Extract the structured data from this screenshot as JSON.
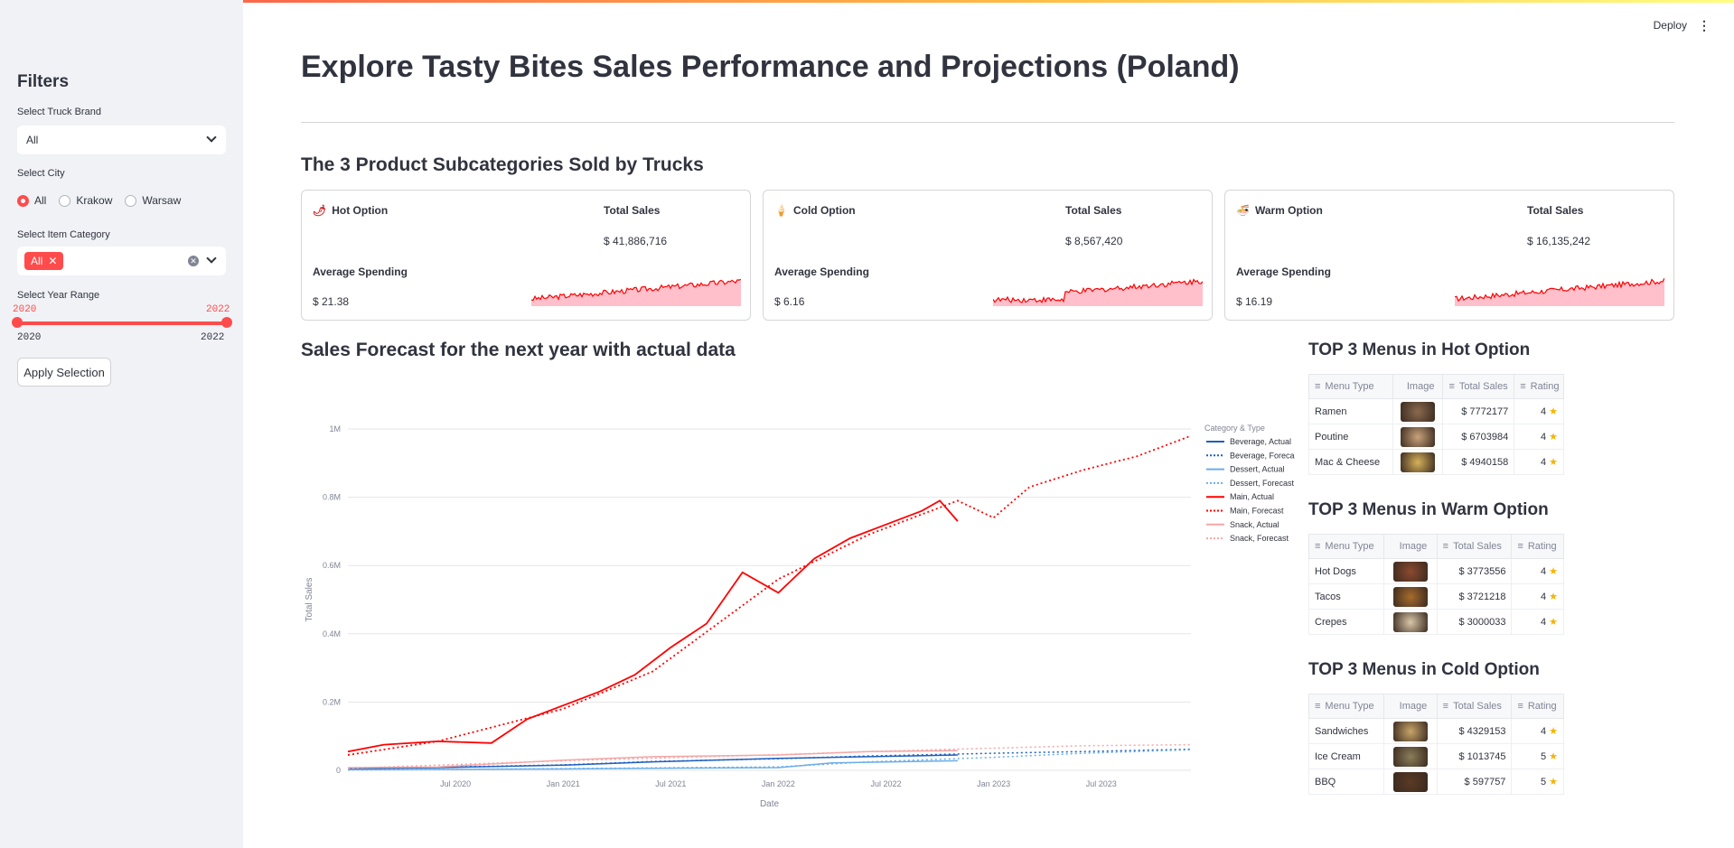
{
  "header": {
    "deploy_label": "Deploy",
    "menu_icon": "kebab-menu-icon"
  },
  "sidebar": {
    "title": "Filters",
    "truck_brand": {
      "label": "Select Truck Brand",
      "value": "All"
    },
    "city": {
      "label": "Select City",
      "options": [
        "All",
        "Krakow",
        "Warsaw"
      ],
      "selected": "All"
    },
    "item_category": {
      "label": "Select Item Category",
      "tag": "All"
    },
    "year_range": {
      "label": "Select Year Range",
      "min": "2020",
      "max": "2022",
      "low": "2020",
      "high": "2022"
    },
    "apply_label": "Apply Selection"
  },
  "main": {
    "title": "Explore Tasty Bites Sales Performance and Projections (Poland)",
    "subcategories_title": "The 3 Product Subcategories Sold by Trucks",
    "cards": [
      {
        "name": "Hot Option",
        "icon": "chili-pepper-icon",
        "total_sales_label": "Total Sales",
        "total_sales": "$ 41,886,716",
        "avg_label": "Average Spending",
        "avg": "$ 21.38"
      },
      {
        "name": "Cold Option",
        "icon": "ice-cream-icon",
        "total_sales_label": "Total Sales",
        "total_sales": "$ 8,567,420",
        "avg_label": "Average Spending",
        "avg": "$ 6.16"
      },
      {
        "name": "Warm Option",
        "icon": "bowl-icon",
        "total_sales_label": "Total Sales",
        "total_sales": "$ 16,135,242",
        "avg_label": "Average Spending",
        "avg": "$ 16.19"
      }
    ],
    "forecast_title": "Sales Forecast for the next year with actual data"
  },
  "tables": [
    {
      "title": "TOP 3 Menus in Hot Option",
      "headers": [
        "Menu Type",
        "Image",
        "Total Sales",
        "Rating"
      ],
      "rows": [
        {
          "menu": "Ramen",
          "sales": "$ 7772177",
          "rating": "4"
        },
        {
          "menu": "Poutine",
          "sales": "$ 6703984",
          "rating": "4"
        },
        {
          "menu": "Mac & Cheese",
          "sales": "$ 4940158",
          "rating": "4"
        }
      ]
    },
    {
      "title": "TOP 3 Menus in Warm Option",
      "headers": [
        "Menu Type",
        "Image",
        "Total Sales",
        "Rating"
      ],
      "rows": [
        {
          "menu": "Hot Dogs",
          "sales": "$ 3773556",
          "rating": "4"
        },
        {
          "menu": "Tacos",
          "sales": "$ 3721218",
          "rating": "4"
        },
        {
          "menu": "Crepes",
          "sales": "$ 3000033",
          "rating": "4"
        }
      ]
    },
    {
      "title": "TOP 3 Menus in Cold Option",
      "headers": [
        "Menu Type",
        "Image",
        "Total Sales",
        "Rating"
      ],
      "rows": [
        {
          "menu": "Sandwiches",
          "sales": "$ 4329153",
          "rating": "4"
        },
        {
          "menu": "Ice Cream",
          "sales": "$ 1013745",
          "rating": "5"
        },
        {
          "menu": "BBQ",
          "sales": "$ 597757",
          "rating": "5"
        }
      ]
    }
  ],
  "colors": {
    "accent": "#ff4b4b",
    "main": "#ff0000",
    "beverage": "#1f5fbf",
    "dessert": "#6aaee8",
    "snack": "#f4a7a7"
  },
  "chart_data": {
    "type": "line",
    "xlabel": "Date",
    "ylabel": "Total Sales",
    "x_ticks": [
      "Jul 2020",
      "Jan 2021",
      "Jul 2021",
      "Jan 2022",
      "Jul 2022",
      "Jan 2023",
      "Jul 2023"
    ],
    "y_ticks": [
      "0",
      "0.2M",
      "0.4M",
      "0.6M",
      "0.8M",
      "1M"
    ],
    "ylim": [
      0,
      1000000
    ],
    "xlim": [
      "2020-01",
      "2023-12"
    ],
    "legend_title": "Category & Type",
    "legend_position": "right",
    "series": [
      {
        "name": "Beverage, Actual",
        "style": "solid",
        "color": "#1f5fbf",
        "points": [
          [
            "2020-01",
            5000
          ],
          [
            "2020-06",
            8000
          ],
          [
            "2021-01",
            15000
          ],
          [
            "2021-06",
            25000
          ],
          [
            "2022-01",
            35000
          ],
          [
            "2022-06",
            40000
          ],
          [
            "2022-11",
            45000
          ]
        ]
      },
      {
        "name": "Beverage, Forecast",
        "style": "dotted",
        "color": "#1f5fbf",
        "points": [
          [
            "2020-01",
            3000
          ],
          [
            "2020-06",
            9000
          ],
          [
            "2021-01",
            16000
          ],
          [
            "2021-06",
            26000
          ],
          [
            "2022-01",
            34000
          ],
          [
            "2022-06",
            42000
          ],
          [
            "2023-01",
            50000
          ],
          [
            "2023-06",
            55000
          ],
          [
            "2023-12",
            62000
          ]
        ]
      },
      {
        "name": "Dessert, Actual",
        "style": "solid",
        "color": "#6aaee8",
        "points": [
          [
            "2020-01",
            2000
          ],
          [
            "2020-06",
            3000
          ],
          [
            "2021-01",
            4000
          ],
          [
            "2021-06",
            6000
          ],
          [
            "2022-01",
            8000
          ],
          [
            "2022-04",
            22000
          ],
          [
            "2022-11",
            28000
          ]
        ]
      },
      {
        "name": "Dessert, Forecast",
        "style": "dotted",
        "color": "#6aaee8",
        "points": [
          [
            "2020-01",
            1000
          ],
          [
            "2021-01",
            5000
          ],
          [
            "2022-01",
            10000
          ],
          [
            "2022-06",
            25000
          ],
          [
            "2023-01",
            38000
          ],
          [
            "2023-06",
            50000
          ],
          [
            "2023-12",
            60000
          ]
        ]
      },
      {
        "name": "Main, Actual",
        "style": "solid",
        "color": "#ff0000",
        "points": [
          [
            "2020-01",
            55000
          ],
          [
            "2020-03",
            75000
          ],
          [
            "2020-06",
            85000
          ],
          [
            "2020-09",
            80000
          ],
          [
            "2020-11",
            150000
          ],
          [
            "2021-01",
            190000
          ],
          [
            "2021-03",
            230000
          ],
          [
            "2021-05",
            280000
          ],
          [
            "2021-07",
            360000
          ],
          [
            "2021-09",
            430000
          ],
          [
            "2021-11",
            580000
          ],
          [
            "2022-01",
            520000
          ],
          [
            "2022-03",
            620000
          ],
          [
            "2022-05",
            680000
          ],
          [
            "2022-07",
            720000
          ],
          [
            "2022-09",
            760000
          ],
          [
            "2022-10",
            790000
          ],
          [
            "2022-11",
            730000
          ]
        ]
      },
      {
        "name": "Main, Forecast",
        "style": "dotted",
        "color": "#ff0000",
        "points": [
          [
            "2020-01",
            45000
          ],
          [
            "2020-06",
            85000
          ],
          [
            "2021-01",
            180000
          ],
          [
            "2021-06",
            290000
          ],
          [
            "2022-01",
            560000
          ],
          [
            "2022-06",
            690000
          ],
          [
            "2022-11",
            790000
          ],
          [
            "2023-01",
            740000
          ],
          [
            "2023-03",
            830000
          ],
          [
            "2023-06",
            880000
          ],
          [
            "2023-09",
            920000
          ],
          [
            "2023-12",
            980000
          ]
        ]
      },
      {
        "name": "Snack, Actual",
        "style": "solid",
        "color": "#f4a7a7",
        "points": [
          [
            "2020-01",
            8000
          ],
          [
            "2020-06",
            10000
          ],
          [
            "2021-01",
            30000
          ],
          [
            "2021-06",
            40000
          ],
          [
            "2022-01",
            45000
          ],
          [
            "2022-06",
            55000
          ],
          [
            "2022-11",
            58000
          ]
        ]
      },
      {
        "name": "Snack, Forecast",
        "style": "dotted",
        "color": "#f4a7a7",
        "points": [
          [
            "2020-01",
            6000
          ],
          [
            "2021-01",
            28000
          ],
          [
            "2022-01",
            46000
          ],
          [
            "2022-06",
            55000
          ],
          [
            "2023-01",
            65000
          ],
          [
            "2023-06",
            72000
          ],
          [
            "2023-12",
            75000
          ]
        ]
      }
    ]
  }
}
